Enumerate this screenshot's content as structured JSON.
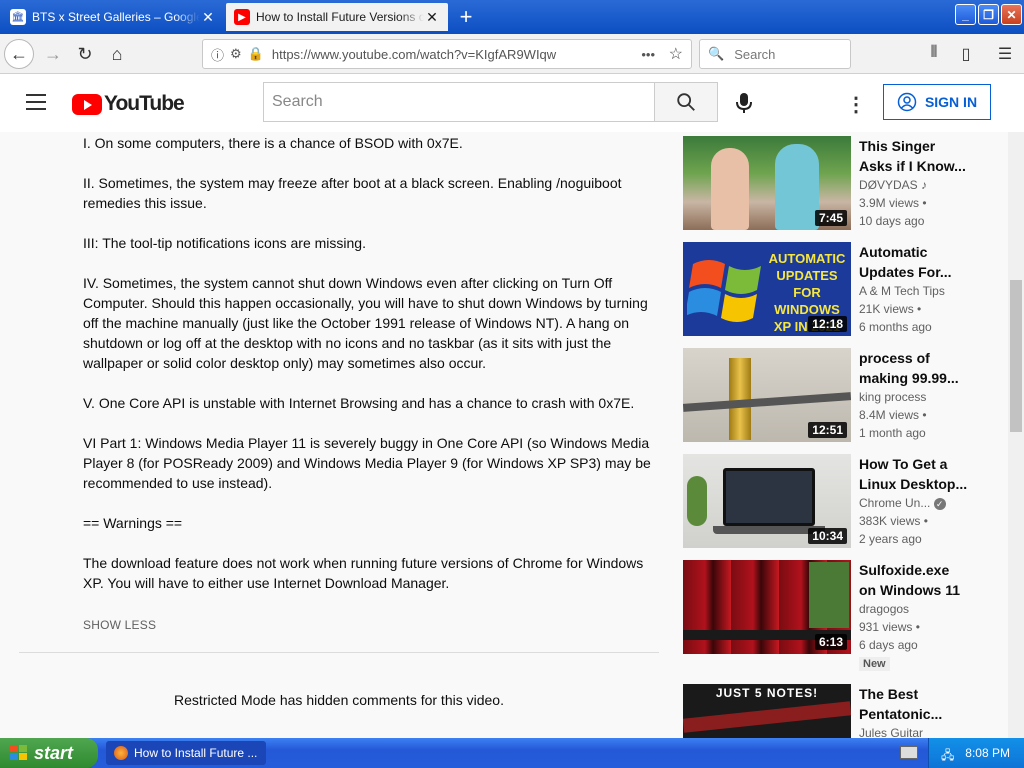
{
  "browser": {
    "tabs": [
      {
        "title": "BTS x Street Galleries – Google Ar",
        "active": false
      },
      {
        "title": "How to Install Future Versions of Ch",
        "active": true
      }
    ],
    "url": "https://www.youtube.com/watch?v=KIgfAR9WIqw",
    "search_placeholder": "Search",
    "url_menu": "•••"
  },
  "youtube": {
    "logo_text": "YouTube",
    "search_placeholder": "Search",
    "sign_in_label": "SIGN IN",
    "description": [
      "I. On some computers, there is a chance of BSOD with 0x7E.",
      "II. Sometimes, the system may freeze after boot at a black screen. Enabling /noguiboot remedies this issue.",
      "III: The tool-tip notifications icons are missing.",
      "IV. Sometimes, the system cannot shut down Windows even after clicking on Turn Off Computer. Should this happen occasionally, you will have to shut down Windows by turning off the machine manually (just like the October 1991 release of Windows NT). A hang on shutdown or log off at the desktop with no icons and no taskbar (as it sits with just the wallpaper or solid color desktop only) may sometimes also occur.",
      "V. One Core API is unstable with Internet Browsing and has a chance to crash with 0x7E.",
      "VI Part 1: Windows Media Player 11 is severely buggy in One Core API (so Windows Media Player 8 (for POSReady 2009) and Windows Media Player 9 (for Windows XP SP3) may be recommended to use instead).",
      "== Warnings ==",
      "The download feature does not work when running future versions of Chrome for Windows XP. You will have to either use Internet Download Manager."
    ],
    "show_less": "SHOW LESS",
    "restricted_notice": "Restricted Mode has hidden comments for this video.",
    "recommendations": [
      {
        "title": "This Singer Asks if I Know...",
        "channel": "DØVYDAS",
        "views": "3.9M views •",
        "age": "10 days ago",
        "duration": "7:45"
      },
      {
        "title": "Automatic Updates For...",
        "channel": "A & M Tech Tips",
        "views": "21K views •",
        "age": "6 months ago",
        "duration": "12:18",
        "thumb_text": "AUTOMATIC UPDATES FOR WINDOWS XP IN 2021"
      },
      {
        "title": "process of making 99.99...",
        "channel": "king process",
        "views": "8.4M views •",
        "age": "1 month ago",
        "duration": "12:51"
      },
      {
        "title": "How To Get a Linux Desktop...",
        "channel": "Chrome Un...",
        "views": "383K views •",
        "age": "2 years ago",
        "duration": "10:34"
      },
      {
        "title": "Sulfoxide.exe on Windows 11",
        "channel": "dragogos",
        "views": "931 views •",
        "age": "6 days ago",
        "duration": "6:13",
        "badge": "New"
      },
      {
        "title": "The Best Pentatonic...",
        "channel": "Jules Guitar",
        "thumb_text": "JUST 5 NOTES!"
      }
    ]
  },
  "taskbar": {
    "start_label": "start",
    "task_item": "How to Install Future ...",
    "clock": "8:08 PM"
  }
}
